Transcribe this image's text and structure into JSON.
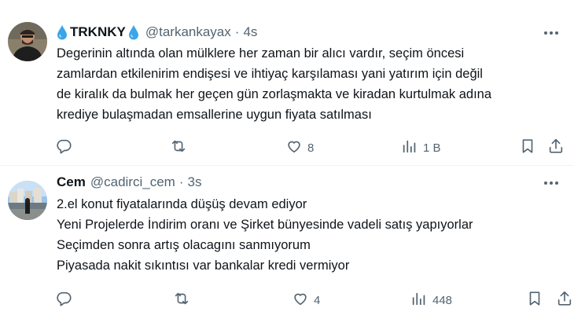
{
  "tweets": [
    {
      "display_name": "TRKNKY",
      "handle": "@tarkankayax",
      "separator": "·",
      "time": "4s",
      "lines": [
        "Degerinin altında olan mülklere her zaman bir alıcı vardır, seçim öncesi",
        "zamlardan etkilenirim endişesi ve ihtiyaç karşılaması yani yatırım için değil",
        "de kiralık da bulmak her geçen gün zorlaşmakta ve kiradan kurtulmak adına",
        "krediye bulaşmadan emsallerine uygun fiyata satılması"
      ],
      "likes": "8",
      "views": "1 B"
    },
    {
      "display_name": "Cem",
      "handle": "@cadirci_cem",
      "separator": "·",
      "time": "3s",
      "lines": [
        "2.el konut fiyatalarında düşüş devam ediyor",
        "Yeni Projelerde İndirim oranı ve Şirket bünyesinde vadeli satış yapıyorlar",
        "Seçimden sonra artış olacagını sanmıyorum",
        "Piyasada nakit sıkıntısı var bankalar kredi vermiyor"
      ],
      "likes": "4",
      "views": "448"
    }
  ],
  "icons": {
    "reply": "reply-icon",
    "retweet": "retweet-icon",
    "like": "like-icon",
    "views": "views-icon",
    "bookmark": "bookmark-icon",
    "share": "share-icon",
    "more": "more-icon",
    "drop": "water-drop-emoji-icon"
  },
  "colors": {
    "text": "#0f1419",
    "secondary": "#536471",
    "divider": "#eff3f4",
    "drop": "#3ba5ea"
  }
}
